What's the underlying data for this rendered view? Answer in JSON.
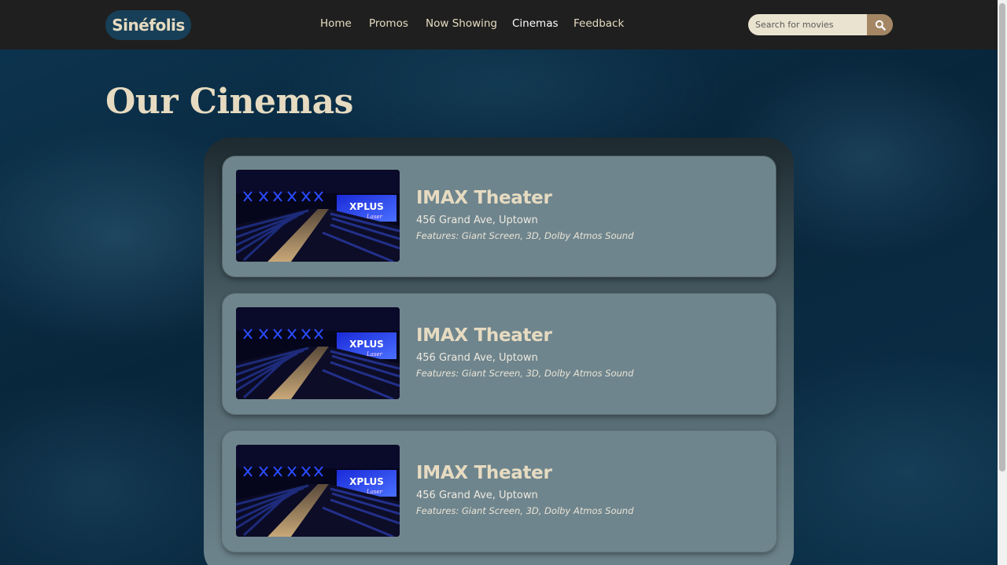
{
  "header": {
    "logo": "Sinéfolis",
    "nav": [
      {
        "label": "Home",
        "active": false
      },
      {
        "label": "Promos",
        "active": false
      },
      {
        "label": "Now Showing",
        "active": false
      },
      {
        "label": "Cinemas",
        "active": true
      },
      {
        "label": "Feedback",
        "active": false
      }
    ],
    "search": {
      "placeholder": "Search for movies",
      "value": "",
      "button_icon": "search-icon"
    }
  },
  "main": {
    "title": "Our Cinemas",
    "cinemas": [
      {
        "name": "IMAX Theater",
        "address": "456 Grand Ave, Uptown",
        "features": "Features: Giant Screen, 3D, Dolby Atmos Sound",
        "image_screen_text": "XPLUS",
        "image_screen_subtext": "Laser"
      },
      {
        "name": "IMAX Theater",
        "address": "456 Grand Ave, Uptown",
        "features": "Features: Giant Screen, 3D, Dolby Atmos Sound",
        "image_screen_text": "XPLUS",
        "image_screen_subtext": "Laser"
      },
      {
        "name": "IMAX Theater",
        "address": "456 Grand Ave, Uptown",
        "features": "Features: Giant Screen, 3D, Dolby Atmos Sound",
        "image_screen_text": "XPLUS",
        "image_screen_subtext": "Laser"
      }
    ]
  },
  "colors": {
    "navbar_bg": "#1f1f1f",
    "accent_text": "#e6dbc1",
    "search_button": "#a48664",
    "card_bg": "#6f858d",
    "page_bg": "#0b3049"
  }
}
